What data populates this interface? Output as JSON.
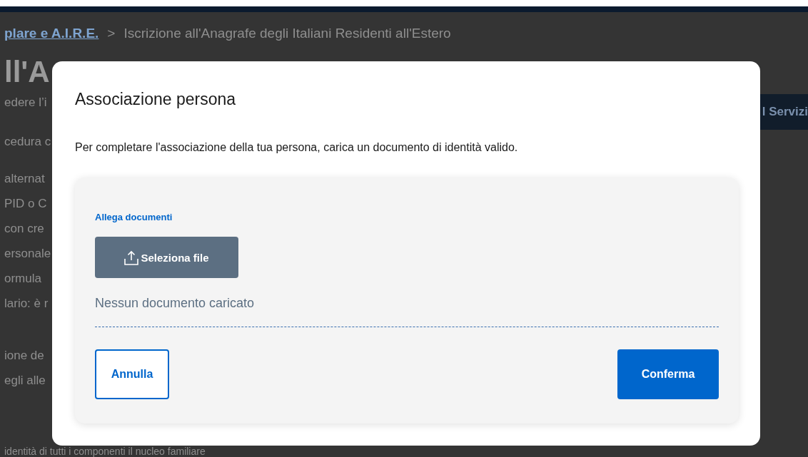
{
  "page": {
    "breadcrumb": {
      "link": "plare e A.I.R.E.",
      "separator": ">",
      "current": "Iscrizione all'Anagrafe degli Italiani Residenti all'Estero"
    },
    "heading": "ll'A",
    "lines": [
      "edere l’i",
      "cedura c",
      "alternat",
      "PID o C",
      "con cre",
      "ersonale",
      "ormula",
      "lario: è r",
      "ione de",
      "egli alle"
    ],
    "bottom_line": "identità di tutti i componenti il nucleo familiare",
    "side_button": "l Servizi"
  },
  "modal": {
    "title": "Associazione persona",
    "description": "Per completare l'associazione della tua persona, carica un documento di identità valido.",
    "upload": {
      "label": "Allega documenti",
      "button": "Seleziona file",
      "status": "Nessun documento caricato"
    },
    "buttons": [
      {
        "label": "Annulla",
        "kind": "secondary"
      },
      {
        "label": "Conferma",
        "kind": "primary"
      }
    ]
  }
}
